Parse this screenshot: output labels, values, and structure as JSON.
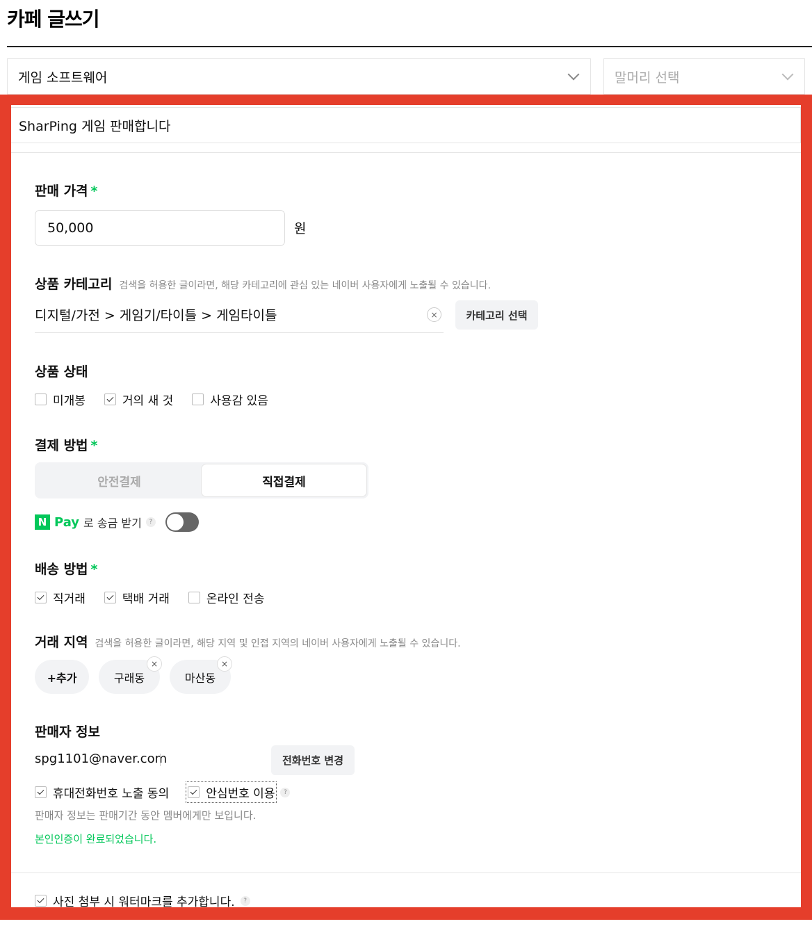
{
  "page": {
    "title": "카페 글쓰기"
  },
  "selects": {
    "board": {
      "value": "게임 소프트웨어"
    },
    "head": {
      "placeholder": "말머리 선택"
    }
  },
  "post": {
    "title": "SharPing 게임 판매합니다"
  },
  "price": {
    "label": "판매 가격",
    "required": "*",
    "value": "50,000",
    "unit": "원"
  },
  "category": {
    "label": "상품 카테고리",
    "hint": "검색을 허용한 글이라면, 해당 카테고리에 관심 있는 네이버 사용자에게 노출될 수 있습니다.",
    "value": "디지털/가전 > 게임기/타이틀 > 게임타이틀",
    "clear": "×",
    "select_button": "카테고리 선택"
  },
  "condition": {
    "label": "상품 상태",
    "options": [
      {
        "label": "미개봉",
        "checked": false
      },
      {
        "label": "거의 새 것",
        "checked": true
      },
      {
        "label": "사용감 있음",
        "checked": false
      }
    ]
  },
  "payment": {
    "label": "결제 방법",
    "required": "*",
    "options": [
      {
        "label": "안전결제",
        "active": false
      },
      {
        "label": "직접결제",
        "active": true
      }
    ],
    "npay": {
      "n": "N",
      "pay": "Pay",
      "text": "로 송금 받기",
      "help": "?",
      "enabled": false
    }
  },
  "delivery": {
    "label": "배송 방법",
    "required": "*",
    "options": [
      {
        "label": "직거래",
        "checked": true
      },
      {
        "label": "택배 거래",
        "checked": true
      },
      {
        "label": "온라인 전송",
        "checked": false
      }
    ]
  },
  "region": {
    "label": "거래 지역",
    "hint": "검색을 허용한 글이라면, 해당 지역 및 인접 지역의 네이버 사용자에게 노출될 수 있습니다.",
    "add": "+추가",
    "items": [
      "구래동",
      "마산동"
    ],
    "remove": "×"
  },
  "seller": {
    "label": "판매자 정보",
    "email": "spg1101@naver.com",
    "change_phone": "전화번호 변경",
    "phone_consent": {
      "label": "휴대전화번호 노출 동의",
      "checked": true
    },
    "safe_number": {
      "label": "안심번호 이용",
      "checked": true,
      "help": "?"
    },
    "note": "판매자 정보는 판매기간 동안 멤버에게만 보입니다.",
    "verified": "본인인증이 완료되었습니다."
  },
  "watermark": {
    "label": "사진 첨부 시 워터마크를 추가합니다.",
    "checked": true,
    "help": "?"
  },
  "colors": {
    "frame": "#e53e2b",
    "accent": "#03c75a"
  }
}
